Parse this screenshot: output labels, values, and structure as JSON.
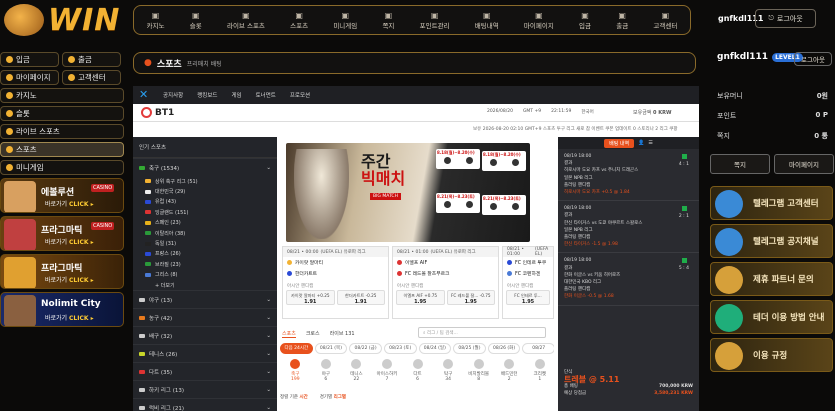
{
  "brand": {
    "logo_text": "WIN"
  },
  "topnav": [
    {
      "label": "카지노",
      "icon": "casino-icon"
    },
    {
      "label": "슬롯",
      "icon": "slot-icon"
    },
    {
      "label": "라이브 스포츠",
      "icon": "live-icon"
    },
    {
      "label": "스포츠",
      "icon": "sports-icon"
    },
    {
      "label": "미니게임",
      "icon": "minigame-icon"
    },
    {
      "label": "쪽지",
      "icon": "mail-icon"
    },
    {
      "label": "포인트관리",
      "icon": "point-icon"
    },
    {
      "label": "배팅내역",
      "icon": "history-icon"
    },
    {
      "label": "마이페이지",
      "icon": "mypage-icon"
    },
    {
      "label": "입금",
      "icon": "deposit-icon"
    },
    {
      "label": "출금",
      "icon": "withdraw-icon"
    },
    {
      "label": "고객센터",
      "icon": "support-icon"
    }
  ],
  "header": {
    "username": "gnfkdl111",
    "logout": "로그아웃"
  },
  "left_sidebar": {
    "deposit": "입금",
    "withdraw": "출금",
    "mypage": "마이페이지",
    "support": "고객센터",
    "casino": "카지노",
    "slot": "슬롯",
    "live_sports": "라이브 스포츠",
    "sports": "스포츠",
    "minigame": "미니게임",
    "promos": [
      {
        "title": "에볼루션",
        "tag": "CASINO",
        "cta_a": "바로가기",
        "cta_b": "CLICK ▸"
      },
      {
        "title": "프라그마틱",
        "tag": "CASINO",
        "cta_a": "바로가기",
        "cta_b": "CLICK ▸"
      },
      {
        "title": "프라그마틱",
        "tag": "",
        "cta_a": "바로가기",
        "cta_b": "CLICK ▸"
      },
      {
        "title": "Nolimit City",
        "tag": "",
        "cta_a": "바로가기",
        "cta_b": "CLICK ▸"
      }
    ]
  },
  "breadcrumb": {
    "title": "스포츠",
    "sub": "프리매치 배팅"
  },
  "right_sidebar": {
    "username": "gnfkdl111",
    "level": "LEVEL1",
    "logout": "로그아웃",
    "rows": [
      {
        "label": "보유머니",
        "value": "0원"
      },
      {
        "label": "포인트",
        "value": "0 P"
      },
      {
        "label": "쪽지",
        "value": "0 통"
      }
    ],
    "btn_a": "쪽지",
    "btn_b": "마이페이지",
    "promos": [
      "텔레그램 고객센터",
      "텔레그램 공지채널",
      "제휴 파트너 문의",
      "테더 이용 방법 안내",
      "이용 규정"
    ]
  },
  "bt1": {
    "topbar": [
      "공지사항",
      "랭킹보드",
      "게임",
      "토너먼트",
      "프로모션"
    ],
    "logo": "BT1",
    "date": "2026/08/20",
    "tz": "GMT +9",
    "time": "22:11:59",
    "lang": "한국어",
    "balance_label": "보유금액",
    "balance": "0 KRW",
    "ticker": "보유 2026-08-20 02:10 GMT+9 스포츠 투구 리그 새로 참 이벤트 쿠폰 업데이트 0 스토리나 2 리그 쿠팡"
  },
  "nav": {
    "header": "인기 스포츠",
    "items": [
      {
        "label": "축구 (1534)",
        "count": "",
        "flag": "#3a3",
        "type": "cat"
      },
      {
        "label": "상위 축구 리그 (51)",
        "count": "",
        "flag": "#f2b233",
        "type": "sub"
      },
      {
        "label": "대한민국 (29)",
        "count": "",
        "flag": "#eee",
        "type": "sub"
      },
      {
        "label": "유럽 (43)",
        "count": "",
        "flag": "#2a4ad6",
        "type": "sub"
      },
      {
        "label": "잉글랜드 (151)",
        "count": "",
        "flag": "#d33",
        "type": "sub"
      },
      {
        "label": "스페인 (23)",
        "count": "",
        "flag": "#e6b01a",
        "type": "sub"
      },
      {
        "label": "이탈리아 (38)",
        "count": "",
        "flag": "#2a9a3a",
        "type": "sub"
      },
      {
        "label": "독일 (31)",
        "count": "",
        "flag": "#222",
        "type": "sub"
      },
      {
        "label": "프랑스 (26)",
        "count": "",
        "flag": "#2a4ad6",
        "type": "sub"
      },
      {
        "label": "브라질 (23)",
        "count": "",
        "flag": "#2a9a3a",
        "type": "sub"
      },
      {
        "label": "그리스 (8)",
        "count": "",
        "flag": "#4a7ad6",
        "type": "sub"
      },
      {
        "label": "+ 더보기",
        "count": "",
        "flag": "transparent",
        "type": "sub"
      },
      {
        "label": "야구 (13)",
        "count": "",
        "flag": "#ccc",
        "type": "cat"
      },
      {
        "label": "농구 (42)",
        "count": "",
        "flag": "#e87a1d",
        "type": "cat"
      },
      {
        "label": "배구 (32)",
        "count": "",
        "flag": "#ccc",
        "type": "cat"
      },
      {
        "label": "테니스 (26)",
        "count": "",
        "flag": "#c8d62a",
        "type": "cat"
      },
      {
        "label": "다트 (35)",
        "count": "",
        "flag": "#d33",
        "type": "cat"
      },
      {
        "label": "하키 리그 (13)",
        "count": "",
        "flag": "#ccc",
        "type": "cat"
      },
      {
        "label": "럭비 리그 (21)",
        "count": "",
        "flag": "#ccc",
        "type": "cat"
      }
    ]
  },
  "banner": {
    "big_a": "주간",
    "big_b": "빅매치",
    "sub": "BIG MATCH",
    "dates": [
      "8.18(월)~8.20(수)",
      "8.18(월)~8.20(수)",
      "8.21(목)~8.23(토)",
      "8.21(목)~8.23(토)"
    ]
  },
  "odds": [
    {
      "time": "08/21 • 00:00",
      "league": "(UEFA EL) 유로파 리그",
      "home": "카이랏 알마티",
      "away": "한더카트트",
      "label": "아시안 핸디캡",
      "b1": "카이랏 알마티 +0.25",
      "o1": "1.91",
      "b2": "한더카트트 -0.25",
      "o2": "1.91",
      "c1": "#f2b233",
      "c2": "#2a4ad6"
    },
    {
      "time": "08/21 • 01:00",
      "league": "(UEFA EL) 유로파 리그",
      "home": "이엘프 AIF",
      "away": "FC 레드볼 잘츠부르크",
      "label": "아시안 핸디캡",
      "b1": "이엘프 AIF +0.75",
      "o1": "1.95",
      "b2": "FC 레드볼 잘... -0.75",
      "o2": "1.95",
      "c1": "#d33",
      "c2": "#d33"
    },
    {
      "time": "08/21 • 01:00",
      "league": "(UEFA EL)",
      "home": "FC 인테르 투쿠",
      "away": "FC 코펜하겐",
      "label": "아시안 핸디캡",
      "b1": "FC 인테르 투...",
      "o1": "1.95",
      "b2": "",
      "o2": "",
      "c1": "#2a4ad6",
      "c2": "#4a7ad6"
    }
  ],
  "tabs": {
    "a": "스포츠",
    "b": "크로스",
    "c": "라이브 131",
    "search": "리그 / 팀 검색..."
  },
  "dates": [
    "다음 24시간",
    "08/21 (목)",
    "08/22 (금)",
    "08/23 (토)",
    "08/24 (일)",
    "08/25 (월)",
    "08/26 (화)",
    "08/27"
  ],
  "sports": [
    {
      "name": "축구",
      "count": "199"
    },
    {
      "name": "야구",
      "count": "6"
    },
    {
      "name": "테니스",
      "count": "22"
    },
    {
      "name": "아이스하키",
      "count": "7"
    },
    {
      "name": "다트",
      "count": "6"
    },
    {
      "name": "탁구",
      "count": "34"
    },
    {
      "name": "비치발리볼",
      "count": "8"
    },
    {
      "name": "배드민턴",
      "count": "2"
    },
    {
      "name": "크리켓",
      "count": "1"
    }
  ],
  "footer": {
    "sort": "정렬 기준",
    "sort_val": "시간",
    "filter": "경기별",
    "filter_val": "리그별"
  },
  "slip": {
    "tab": "배팅 내역",
    "bets": [
      {
        "time": "08/19 18:00",
        "status": "결과",
        "match": "히로시마 도요 카프 vs 주니치 드래곤스",
        "league": "일본 NPB 리그",
        "market": "플러팅 핸디캡",
        "pick": "히로시마 도요 카프 +0.5 @ 1.84",
        "score": "4 : 1"
      },
      {
        "time": "08/19 18:00",
        "status": "결과",
        "match": "한신 타이거스 vs 도쿄 야쿠르트 스왈로스",
        "league": "일본 NPB 리그",
        "market": "플러팅 핸디캡",
        "pick": "한신 타이거스 -1.5 @ 1.98",
        "score": "2 : 1"
      },
      {
        "time": "08/19 18:00",
        "status": "결과",
        "match": "한화 이글스 vs 키움 히어로즈",
        "league": "대한민국 KBO 리그",
        "market": "플러팅 핸디캡",
        "pick": "한화 이글스 -0.5 @ 1.68",
        "score": "5 : 4"
      }
    ],
    "foot_label": "단식",
    "foot_odds": "트레블 @ 5.11",
    "amount_label": "총 배팅",
    "amount": "700,000 KRW",
    "win_label": "예상 당첨금",
    "win": "3,580,231 KRW"
  }
}
